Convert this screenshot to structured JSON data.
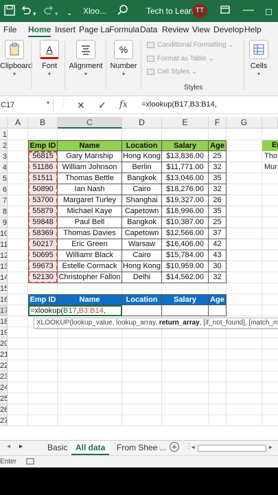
{
  "titlebar": {
    "autosave_icon": "autosave-toggle-icon",
    "undo_icon": "undo-icon",
    "redo_icon": "redo-icon",
    "more_icon": "chevron-down-icon",
    "filename": "Xloo...",
    "search_icon": "magnifier-icon",
    "account_name": "Tech to Learn",
    "avatar_initials": "TT",
    "bg_color": "#1e6e42"
  },
  "ribbon_tabs": [
    {
      "label": "File"
    },
    {
      "label": "Home",
      "active": true
    },
    {
      "label": "Insert"
    },
    {
      "label": "Page La"
    },
    {
      "label": "Formula"
    },
    {
      "label": "Data"
    },
    {
      "label": "Review"
    },
    {
      "label": "View"
    },
    {
      "label": "Develop"
    },
    {
      "label": "Help"
    }
  ],
  "ribbon": {
    "clipboard": "Clipboard",
    "font": "Font",
    "font_icon_glyph": "A",
    "alignment": "Alignment",
    "number": "Number",
    "number_icon_glyph": "%",
    "conditional_formatting": "Conditional Formatting",
    "format_as_table": "Format as Table",
    "cell_styles": "Cell Styles",
    "styles_group": "Styles",
    "cells": "Cells"
  },
  "formula_bar": {
    "name_box": "C17",
    "formula": "=xlookup(B17,B3:B14,"
  },
  "columns": [
    "A",
    "B",
    "C",
    "D",
    "E",
    "F",
    "G"
  ],
  "rows": [
    "1",
    "2",
    "3",
    "4",
    "5",
    "6",
    "7",
    "8",
    "9",
    "10",
    "11",
    "12",
    "13",
    "14",
    "15",
    "16",
    "17",
    "18",
    "19",
    "20",
    "21",
    "22",
    "23",
    "24",
    "25",
    "26",
    "27"
  ],
  "table1": {
    "headers": [
      "Emp ID",
      "Name",
      "Location",
      "Salary",
      "Age"
    ],
    "rows": [
      [
        "56815",
        "Gary Manship",
        "Hong Kong",
        "$13,836.00",
        "25"
      ],
      [
        "51186",
        "William Johnson",
        "Berlin",
        "$11,771.00",
        "32"
      ],
      [
        "51511",
        "Thomas Bettle",
        "Bangkok",
        "$13,046.00",
        "35"
      ],
      [
        "50890",
        "Ian Nash",
        "Cairo",
        "$18,276.00",
        "32"
      ],
      [
        "53700",
        "Margaret Turley",
        "Shanghai",
        "$19,327.00",
        "26"
      ],
      [
        "55879",
        "Michael Kaye",
        "Capetown",
        "$18,996.00",
        "35"
      ],
      [
        "59848",
        "Paul Bell",
        "Bangkok",
        "$10,387.00",
        "25"
      ],
      [
        "58369",
        "Thomas Davies",
        "Capetown",
        "$12,566.00",
        "37"
      ],
      [
        "50217",
        "Eric Green",
        "Warsaw",
        "$16,406.00",
        "42"
      ],
      [
        "50695",
        "Williamr Black",
        "Cairo",
        "$15,784.00",
        "43"
      ],
      [
        "59673",
        "Estelle Cormack",
        "Hong Kong",
        "$10,959.00",
        "30"
      ],
      [
        "52130",
        "Christopher Fallon",
        "Delhi",
        "$14,562.00",
        "32"
      ]
    ]
  },
  "table2": {
    "headers": [
      "Emp ID",
      "Name",
      "Location",
      "Salary",
      "Age"
    ],
    "edit_prefix": "=xlookup(",
    "edit_ref1": "B17",
    "edit_comma": ",",
    "edit_ref2": "B3:B14",
    "edit_suffix": ","
  },
  "side": {
    "header": "Em",
    "row3": "Tho",
    "row4": "Mur"
  },
  "tooltip": {
    "prefix": "XLOOKUP(lookup_value, lookup_array, ",
    "bold": "return_array",
    "suffix": ", [if_not_found], [match_mode"
  },
  "sheets": {
    "basic": "Basic",
    "all_data": "All data",
    "from_sheet": "From Shee ...",
    "add_icon": "plus-icon"
  },
  "statusbar": {
    "mode": "Enter"
  },
  "colors": {
    "header_green": "#92d050",
    "header_blue": "#0f6fc6",
    "ref_red": "#c0504d",
    "accent": "#1e6e42"
  }
}
